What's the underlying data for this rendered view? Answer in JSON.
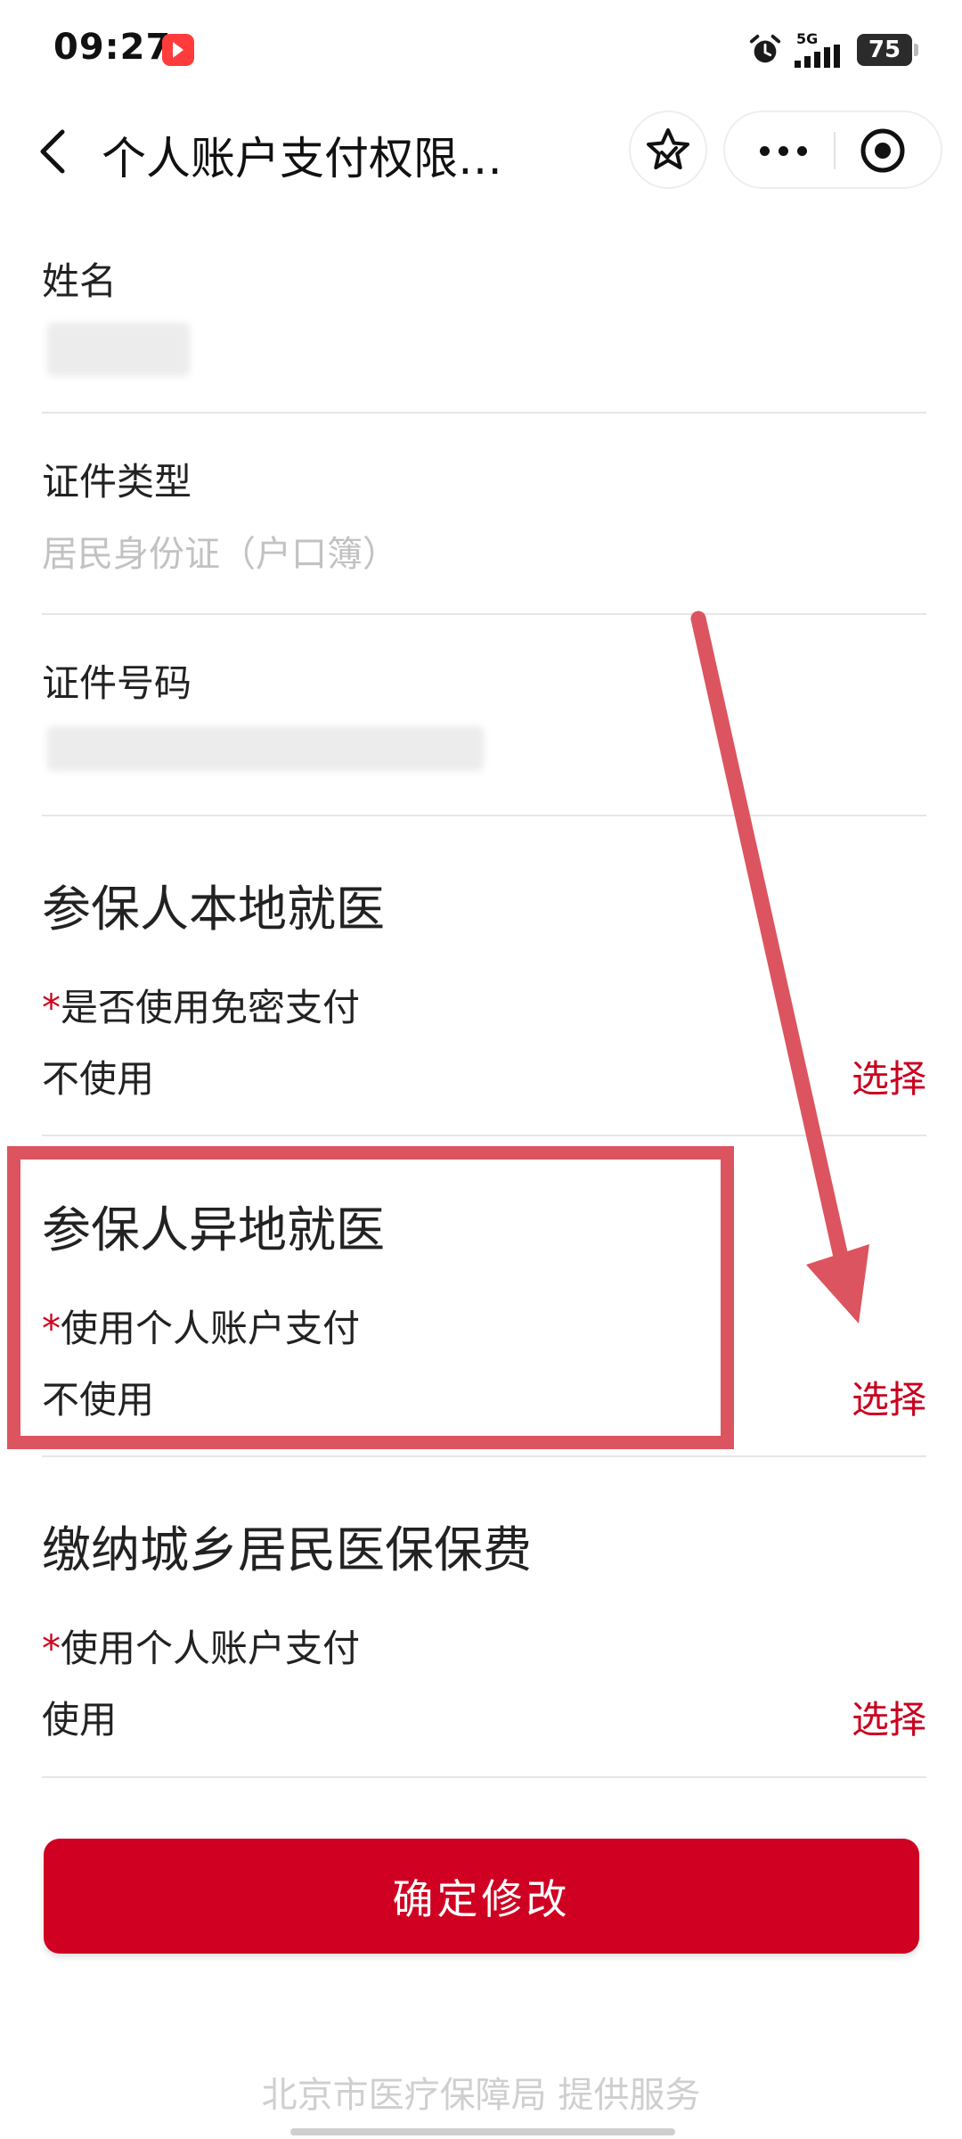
{
  "status_bar": {
    "time": "09:27",
    "network": "5G",
    "battery": "75"
  },
  "nav": {
    "title": "个人账户支付权限…"
  },
  "form": {
    "name_label": "姓名",
    "id_type_label": "证件类型",
    "id_type_value": "居民身份证（户口簿）",
    "id_number_label": "证件号码"
  },
  "sections": [
    {
      "title": "参保人本地就医",
      "required_mark": "*",
      "label": "是否使用免密支付",
      "value": "不使用",
      "action": "选择"
    },
    {
      "title": "参保人异地就医",
      "required_mark": "*",
      "label": "使用个人账户支付",
      "value": "不使用",
      "action": "选择"
    },
    {
      "title": "缴纳城乡居民医保保费",
      "required_mark": "*",
      "label": "使用个人账户支付",
      "value": "使用",
      "action": "选择"
    }
  ],
  "submit_label": "确定修改",
  "footer_text": "北京市医疗保障局  提供服务",
  "colors": {
    "accent": "#cf0022",
    "link": "#c9021f",
    "annotation": "#dc545f"
  }
}
